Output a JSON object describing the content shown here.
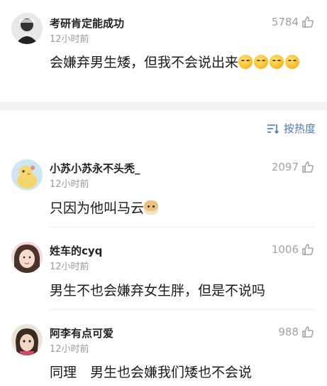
{
  "top_comment": {
    "username": "考研肯定能成功",
    "time": "12小时前",
    "likes": "5784",
    "text": "会嫌弃男生矮，但我不会说出来"
  },
  "sort_bar": {
    "label": "按热度"
  },
  "comments": [
    {
      "username": "小苏小苏永不头秃_",
      "time": "12小时前",
      "likes": "2097",
      "text": "只因为他叫马云"
    },
    {
      "username": "姓车的cyq",
      "time": "12小时前",
      "likes": "1006",
      "text": "男生不也会嫌弃女生胖，但是不说吗"
    },
    {
      "username": "阿李有点可爱",
      "time": "12小时前",
      "likes": "988",
      "text": "同理　男生也会嫌我们矮也不会说"
    }
  ],
  "colors": {
    "accent": "#4a7bb5",
    "meta": "#9a9a9a",
    "separator": "#f2f2f2"
  },
  "icons": [
    "thumbs-up-icon",
    "sort-icon",
    "smiling-emoji",
    "dog-emoji"
  ]
}
